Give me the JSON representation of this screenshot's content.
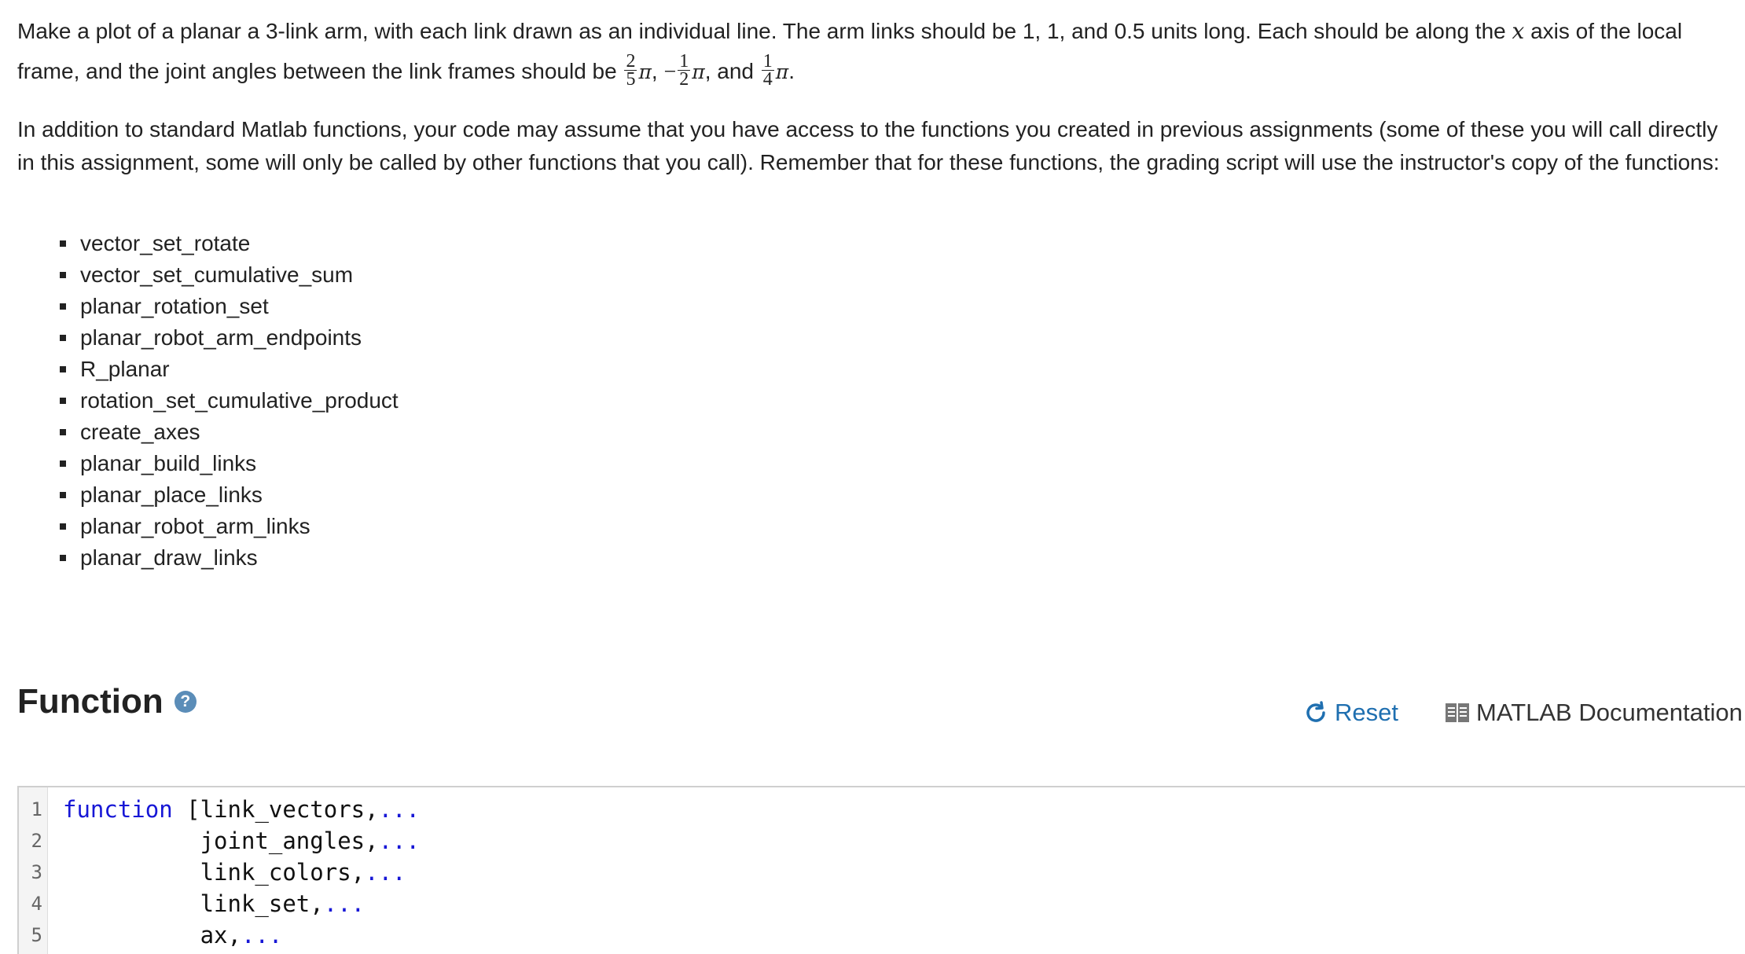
{
  "description": {
    "p1_a": "Make a plot of a planar a 3-link arm, with each link drawn as an individual line. The arm links should be 1, 1, and 0.5 units long. Each should be along the ",
    "p1_var": "x",
    "p1_b": " axis of the local frame, and the joint angles between the link frames should be ",
    "frac1_num": "2",
    "frac1_den": "5",
    "frac2_num": "1",
    "frac2_den": "2",
    "frac3_num": "1",
    "frac3_den": "4",
    "pi": "π",
    "minus": "−",
    "sep1": ",",
    "sep2": ", and",
    "end": ".",
    "p2": "In addition to standard Matlab functions, your code may assume that you have access to the functions you created in previous assignments (some of these you will call directly in this assignment, some will only be called by other functions that you call). Remember that for these functions, the grading script will use the instructor's copy of the functions:"
  },
  "functions": [
    "vector_set_rotate",
    "vector_set_cumulative_sum",
    "planar_rotation_set",
    "planar_robot_arm_endpoints",
    "R_planar",
    "rotation_set_cumulative_product",
    "create_axes",
    "planar_build_links",
    "planar_place_links",
    "planar_robot_arm_links",
    "planar_draw_links"
  ],
  "section": {
    "title": "Function",
    "help_icon": "question-icon"
  },
  "toolbar": {
    "reset_label": "Reset",
    "docs_label": "MATLAB Documentation"
  },
  "editor": {
    "lines": [
      {
        "num": "1",
        "kw": "function",
        "text": " [link_vectors,",
        "ell": "..."
      },
      {
        "num": "2",
        "kw": "",
        "text": "          joint_angles,",
        "ell": "..."
      },
      {
        "num": "3",
        "kw": "",
        "text": "          link_colors,",
        "ell": "..."
      },
      {
        "num": "4",
        "kw": "",
        "text": "          link_set,",
        "ell": "..."
      },
      {
        "num": "5",
        "kw": "",
        "text": "          ax,",
        "ell": "..."
      }
    ]
  },
  "colors": {
    "link": "#1f6fb0",
    "keyword": "#1717d6",
    "help": "#5b8db8"
  }
}
